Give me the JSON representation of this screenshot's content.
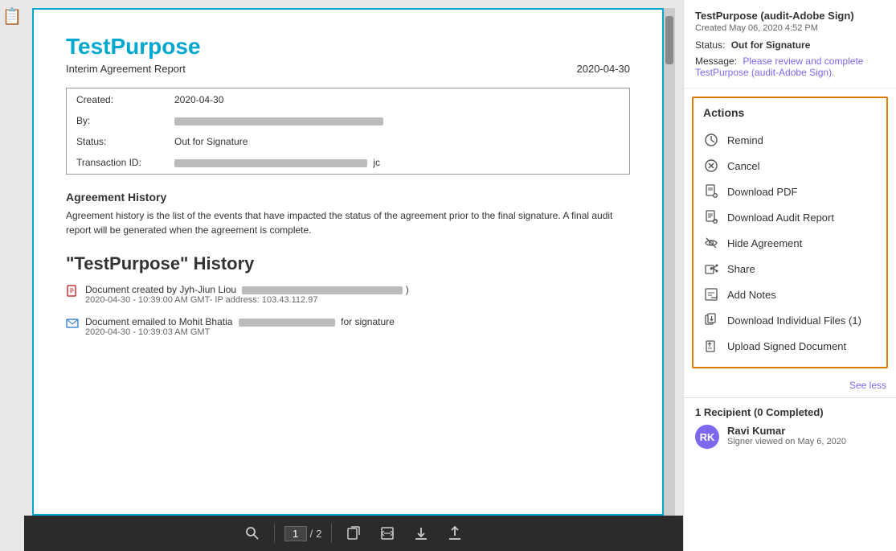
{
  "leftThumb": {
    "icon": "📄"
  },
  "document": {
    "title": "TestPurpose",
    "subtitle": "Interim Agreement Report",
    "date": "2020-04-30",
    "table": {
      "rows": [
        {
          "label": "Created:",
          "value": "2020-04-30",
          "redacted": false
        },
        {
          "label": "By:",
          "value": "",
          "redacted": true,
          "barWidth": "260px"
        },
        {
          "label": "Status:",
          "value": "Out for Signature",
          "redacted": false
        },
        {
          "label": "Transaction ID:",
          "value": "",
          "redacted": true,
          "barWidth": "240px"
        }
      ]
    },
    "history": {
      "sectionTitle": "Agreement History",
      "sectionText": "Agreement history is the list of the events that have impacted the status of the agreement prior to the final signature. A final audit report will be generated when the agreement is complete.",
      "heading": "\"TestPurpose\" History",
      "items": [
        {
          "type": "created",
          "line": "Document created by Jyh-Jiun Liou",
          "date": "2020-04-30 - 10:39:00 AM GMT- IP address: 103.43.112.97",
          "redacted": true
        },
        {
          "type": "emailed",
          "line": "Document emailed to Mohit Bhatia",
          "suffix": "for signature",
          "date": "2020-04-30 - 10:39:03 AM GMT",
          "redacted": true
        }
      ]
    }
  },
  "toolbar": {
    "searchLabel": "🔍",
    "pageInput": "1",
    "pageSeparator": "/",
    "pageTotal": "2",
    "icon1": "📄",
    "icon2": "📋",
    "icon3": "⬇",
    "icon4": "⬆"
  },
  "rightPanel": {
    "docTitle": "TestPurpose (audit-Adobe Sign)",
    "created": "Created May 06, 2020 4:52 PM",
    "statusLabel": "Status:",
    "statusValue": "Out for Signature",
    "messageLabel": "Message:",
    "messageText": "Please review and complete TestPurpose (audit-Adobe Sign).",
    "actions": {
      "title": "Actions",
      "items": [
        {
          "id": "remind",
          "label": "Remind",
          "icon": "clock"
        },
        {
          "id": "cancel",
          "label": "Cancel",
          "icon": "x-circle"
        },
        {
          "id": "download-pdf",
          "label": "Download PDF",
          "icon": "pdf"
        },
        {
          "id": "download-audit",
          "label": "Download Audit Report",
          "icon": "audit"
        },
        {
          "id": "hide",
          "label": "Hide Agreement",
          "icon": "hide"
        },
        {
          "id": "share",
          "label": "Share",
          "icon": "share"
        },
        {
          "id": "notes",
          "label": "Add Notes",
          "icon": "notes"
        },
        {
          "id": "download-files",
          "label": "Download Individual Files (1)",
          "icon": "files"
        },
        {
          "id": "upload",
          "label": "Upload Signed Document",
          "icon": "upload"
        }
      ],
      "seeLess": "See less"
    },
    "recipient": {
      "header": "1 Recipient (0 Completed)",
      "name": "Ravi Kumar",
      "viewed": "Signer viewed on May 6, 2020",
      "initials": "RK"
    }
  }
}
